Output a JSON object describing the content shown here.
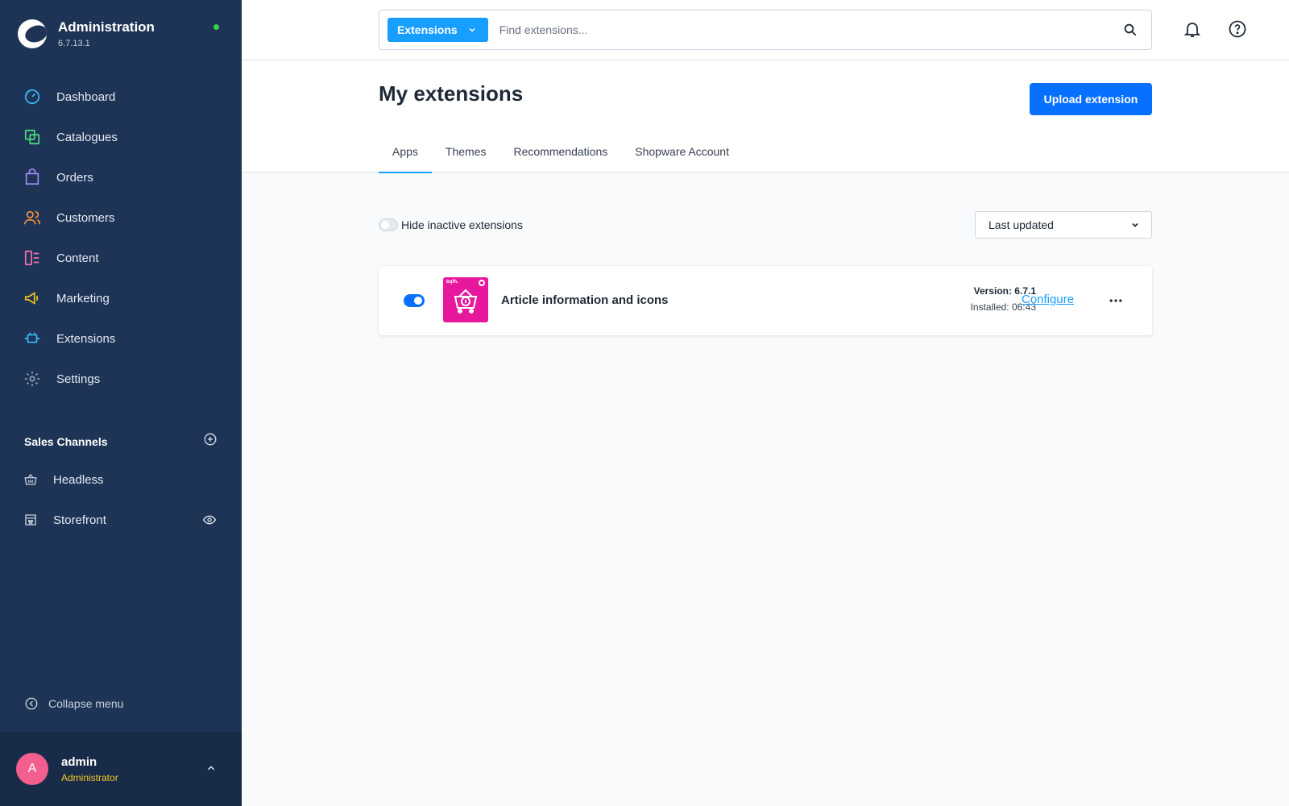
{
  "app": {
    "title": "Administration",
    "version": "6.7.13.1",
    "status_color": "#37d046"
  },
  "sidebar": {
    "items": [
      {
        "label": "Dashboard",
        "icon": "dashboard-icon",
        "color": "#38bdf8"
      },
      {
        "label": "Catalogues",
        "icon": "catalogue-icon",
        "color": "#4ade80"
      },
      {
        "label": "Orders",
        "icon": "orders-icon",
        "color": "#a78bfa"
      },
      {
        "label": "Customers",
        "icon": "customers-icon",
        "color": "#fb923c"
      },
      {
        "label": "Content",
        "icon": "content-icon",
        "color": "#f472b6"
      },
      {
        "label": "Marketing",
        "icon": "marketing-icon",
        "color": "#facc15"
      },
      {
        "label": "Extensions",
        "icon": "extensions-icon",
        "color": "#38bdf8"
      },
      {
        "label": "Settings",
        "icon": "settings-icon",
        "color": "#94a3b8"
      }
    ],
    "sales_channels": {
      "title": "Sales Channels",
      "items": [
        {
          "label": "Headless",
          "icon": "basket-icon"
        },
        {
          "label": "Storefront",
          "icon": "storefront-icon"
        }
      ]
    },
    "collapse_label": "Collapse menu",
    "user": {
      "initial": "A",
      "name": "admin",
      "role": "Administrator"
    }
  },
  "topbar": {
    "search_type": "Extensions",
    "search_placeholder": "Find extensions..."
  },
  "page": {
    "title": "My extensions",
    "upload_label": "Upload extension",
    "tabs": [
      {
        "label": "Apps",
        "active": true
      },
      {
        "label": "Themes",
        "active": false
      },
      {
        "label": "Recommendations",
        "active": false
      },
      {
        "label": "Shopware Account",
        "active": false
      }
    ]
  },
  "filters": {
    "hide_inactive_label": "Hide inactive extensions",
    "hide_inactive": false,
    "sort_value": "Last updated"
  },
  "extensions": [
    {
      "name": "Article information and icons",
      "icon_tag": "bqfh.",
      "active": true,
      "version": "Version: 6.7.1",
      "installed": "Installed: 06:43",
      "configure_label": "Configure"
    }
  ],
  "colors": {
    "sidebar_bg": "#1e3456",
    "accent": "#189eff",
    "primary_button": "#0870ff",
    "extension_icon": "#e8189e",
    "role": "#f7c82b",
    "avatar": "#f25e8d"
  }
}
